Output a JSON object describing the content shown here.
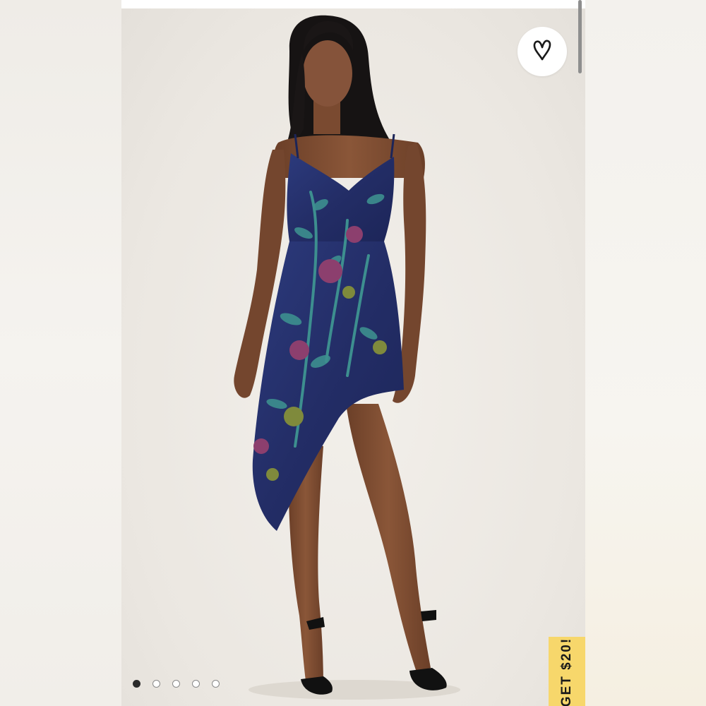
{
  "product_image": {
    "alt_subject": "model-in-blue-floral-asymmetric-dress",
    "colors": {
      "background": "#ebe7e1",
      "dress_primary": "#25306a",
      "dress_accent_teal": "#3d8f8f",
      "dress_accent_rose": "#8c3f6e",
      "dress_accent_olive": "#7f8a3c",
      "skin": "#7a4a30"
    }
  },
  "favorite": {
    "icon": "heart-icon"
  },
  "promo": {
    "label": "GET $20!",
    "color": "#f7d76b"
  },
  "carousel": {
    "total": 5,
    "active_index": 0
  }
}
